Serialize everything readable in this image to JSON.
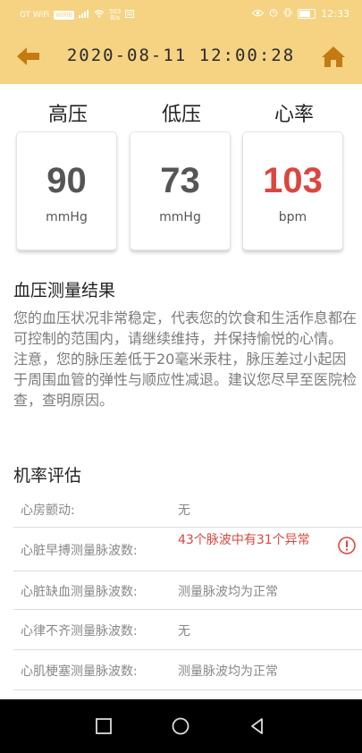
{
  "status_bar": {
    "carrier": "GT WiFi",
    "net_chip": "WiFi6",
    "net_speed_value": "503",
    "net_speed_unit": "B/s",
    "time": "12:33"
  },
  "header": {
    "datetime": "2020-08-11 12:00:28",
    "back_icon": "back-arrow-icon",
    "home_icon": "home-icon"
  },
  "metrics": [
    {
      "label": "高压",
      "value": "90",
      "unit": "mmHg"
    },
    {
      "label": "低压",
      "value": "73",
      "unit": "mmHg"
    },
    {
      "label": "心率",
      "value": "103",
      "unit": "bpm"
    }
  ],
  "result": {
    "title": "血压测量结果",
    "paragraph1": "您的血压状况非常稳定，代表您的饮食和生活作息都在可控制的范围内，请继续维持，并保持愉悦的心情。",
    "paragraph2": "注意，您的脉压差低于20毫米汞柱，脉压差过小起因于周围血管的弹性与顺应性减退。建议您尽早至医院检查，查明原因。"
  },
  "assessment": {
    "title": "机率评估",
    "rows": [
      {
        "label": "心房颤动:",
        "value": "无"
      },
      {
        "label": "心脏早搏测量脉波数:",
        "value": "43个脉波中有31个异常"
      },
      {
        "label": "心脏缺血测量脉波数:",
        "value": "测量脉波均为正常"
      },
      {
        "label": "心律不齐测量脉波数:",
        "value": "无"
      },
      {
        "label": "心肌梗塞测量脉波数:",
        "value": "测量脉波均为正常"
      }
    ]
  },
  "colors": {
    "header": "#f5d383",
    "accent_dark": "#c47a12",
    "alert": "#d9473f"
  }
}
